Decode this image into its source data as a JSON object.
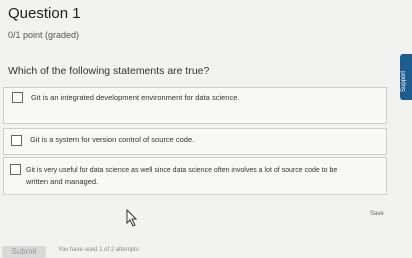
{
  "question": {
    "title": "Question 1",
    "points": "0/1 point (graded)",
    "prompt": "Which of the following statements are true?"
  },
  "options": [
    {
      "label": "Git is an integrated development environment for data science."
    },
    {
      "label": "Git is a system for version control of source code."
    },
    {
      "label": "Git is very useful for data science as well since data science often involves a lot of source code to be",
      "label2": "written and managed."
    }
  ],
  "actions": {
    "save_label": "Save",
    "submit_label": "Submit",
    "attempts_text": "You have used 1 of 2 attempts"
  },
  "side_tab": {
    "label": "Support"
  },
  "colors": {
    "support_tab": "#1f5c8e",
    "background": "#f2f2f0"
  }
}
